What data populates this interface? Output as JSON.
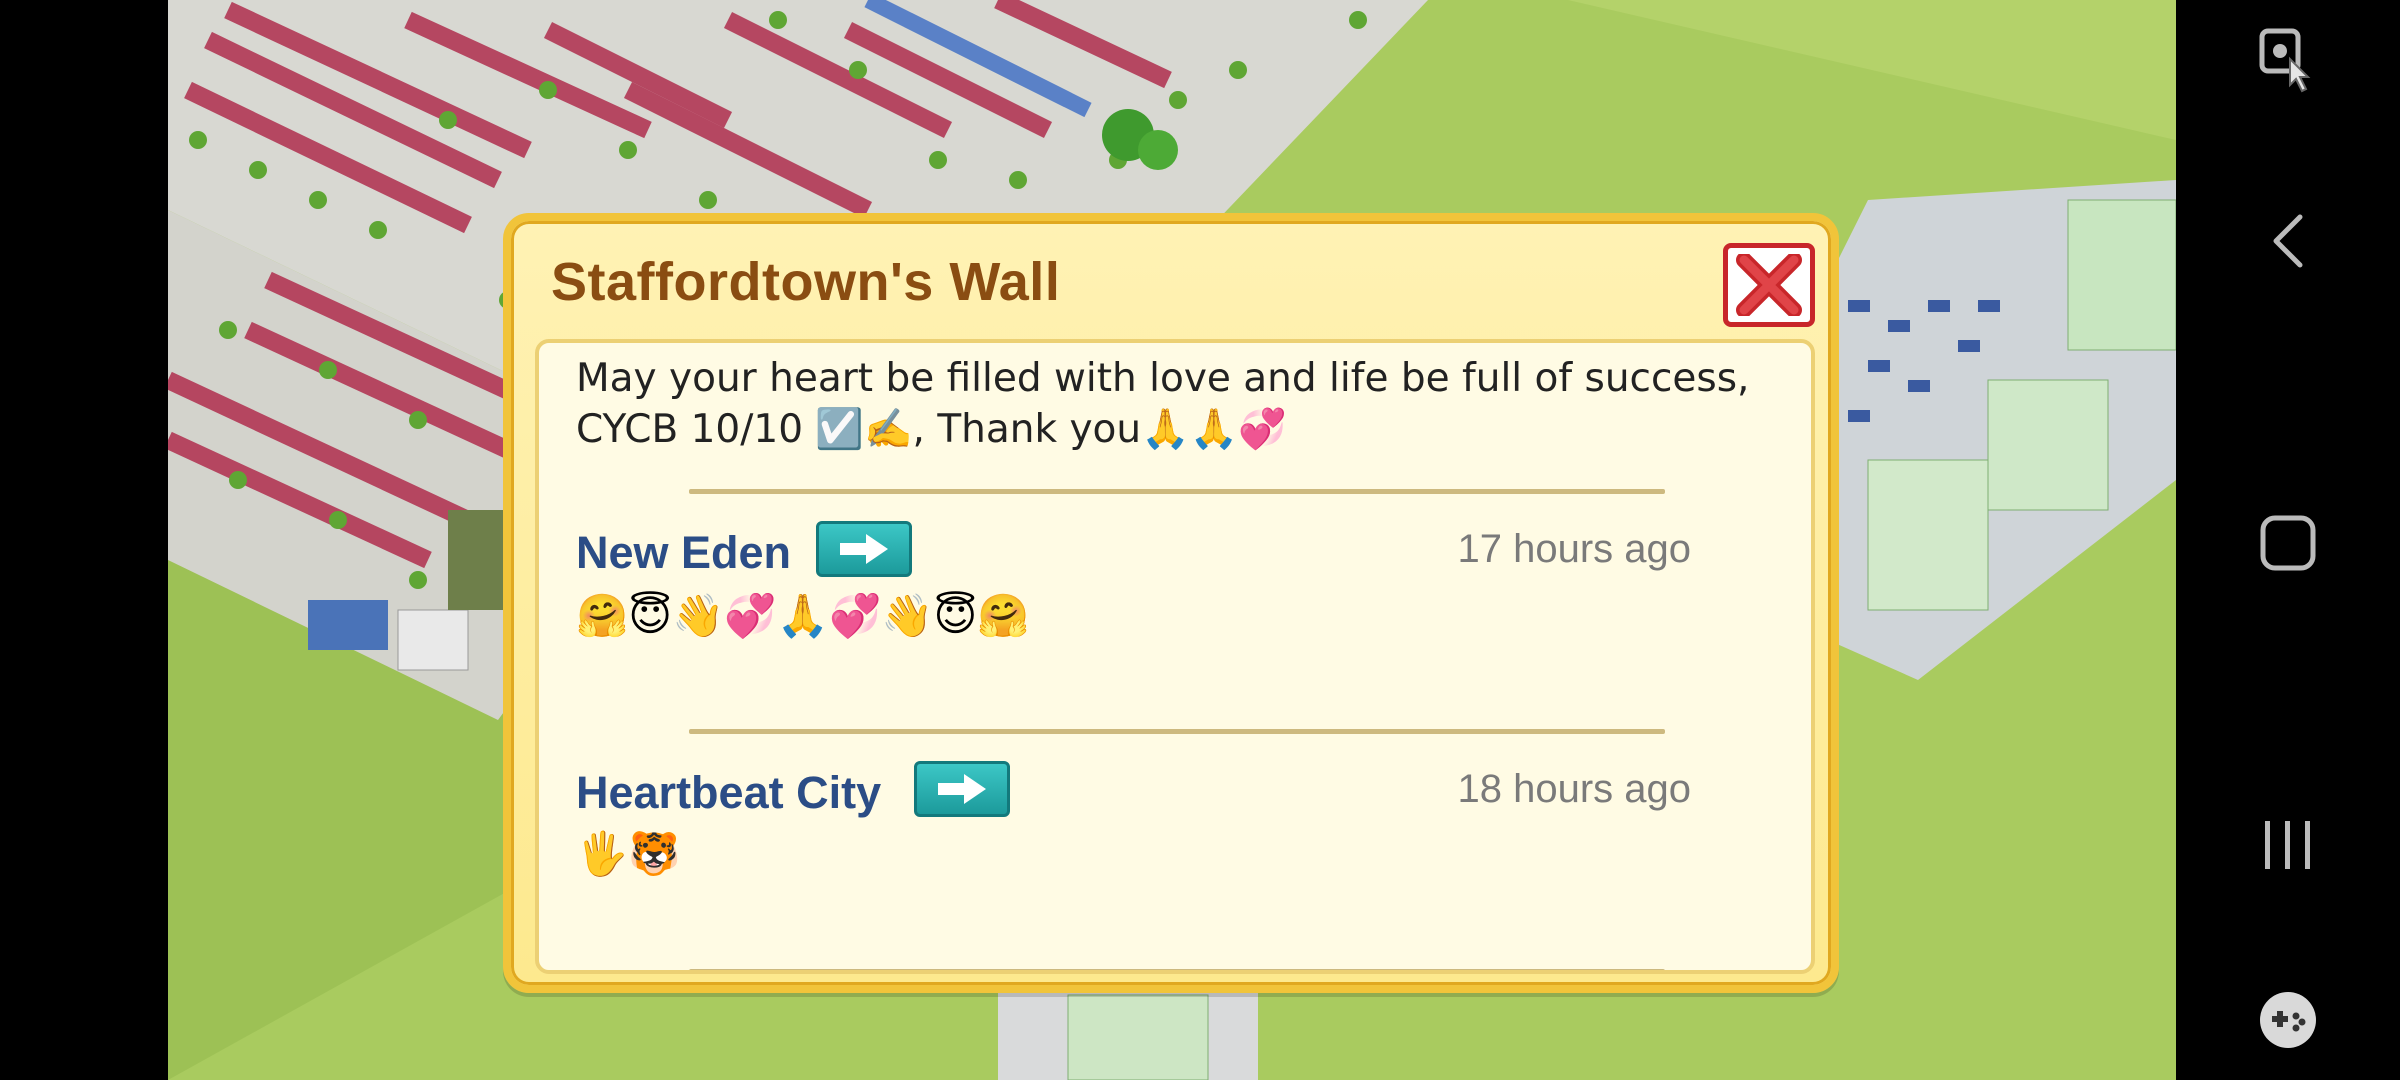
{
  "dialog": {
    "title": "Staffordtown's Wall",
    "messages": [
      {
        "author": "",
        "time": "",
        "text_line1": "May your heart be filled with love and life be full of success,",
        "text_line2": "CYCB 10/10 ☑️✍️, Thank you🙏🙏💞"
      },
      {
        "author": "New Eden",
        "time": "17 hours ago",
        "text": "🤗😇👋💞🙏💞👋😇🤗"
      },
      {
        "author": "Heartbeat City",
        "time": "18 hours ago",
        "text": "🖐🐯"
      }
    ]
  },
  "icons": {
    "close": "close-x-icon",
    "goto": "arrow-right-icon",
    "nav": [
      "screenshot-touch-icon",
      "back-chevron-icon",
      "home-square-icon",
      "recents-icon",
      "game-controller-icon"
    ]
  },
  "colors": {
    "title": "#8a4d12",
    "author": "#2b4d86",
    "dialog_border": "#f1c43a",
    "close_red": "#c8262a",
    "goto_teal": "#1c9a9b"
  }
}
